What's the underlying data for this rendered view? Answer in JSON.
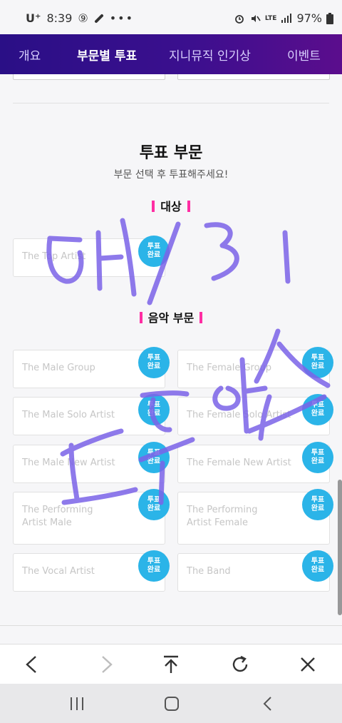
{
  "status": {
    "carrier": "U⁺",
    "time": "8:39",
    "badge": "⑨",
    "battery": "97%",
    "lte": "LTE"
  },
  "nav": {
    "tabs": [
      {
        "label": "개요"
      },
      {
        "label": "부문별 투표"
      },
      {
        "label": "지니뮤직 인기상"
      },
      {
        "label": "이벤트"
      }
    ]
  },
  "section": {
    "title": "투표 부문",
    "subtitle": "부문 선택 후 투표해주세요!"
  },
  "categories": {
    "grand": "대상",
    "music": "음악 부문"
  },
  "badge": {
    "line1": "투표",
    "line2": "완료"
  },
  "cards": {
    "top": "The Top Artist",
    "male_group": "The Male Group",
    "female_group": "The Female Group",
    "male_solo": "The Male Solo Artist",
    "female_solo": "The Female Solo Artist",
    "male_new": "The Male New Artist",
    "female_new": "The Female New Artist",
    "perf_male_1": "The Performing",
    "perf_male_2": "Artist Male",
    "perf_female_1": "The Performing",
    "perf_female_2": "Artist Female",
    "vocal": "The Vocal Artist",
    "band": "The Band"
  },
  "colors": {
    "nav_start": "#2a0f86",
    "nav_end": "#5b0d8d",
    "badge": "#2bb4e8",
    "accent_bar": "#ff2ea3",
    "scribble": "#7b63e8"
  },
  "icons": {
    "back": "back-arrow-icon",
    "forward": "forward-arrow-icon",
    "top": "scroll-top-icon",
    "refresh": "refresh-icon",
    "close": "close-icon",
    "recents": "recents-icon",
    "home": "home-icon",
    "sys_back": "system-back-icon"
  }
}
